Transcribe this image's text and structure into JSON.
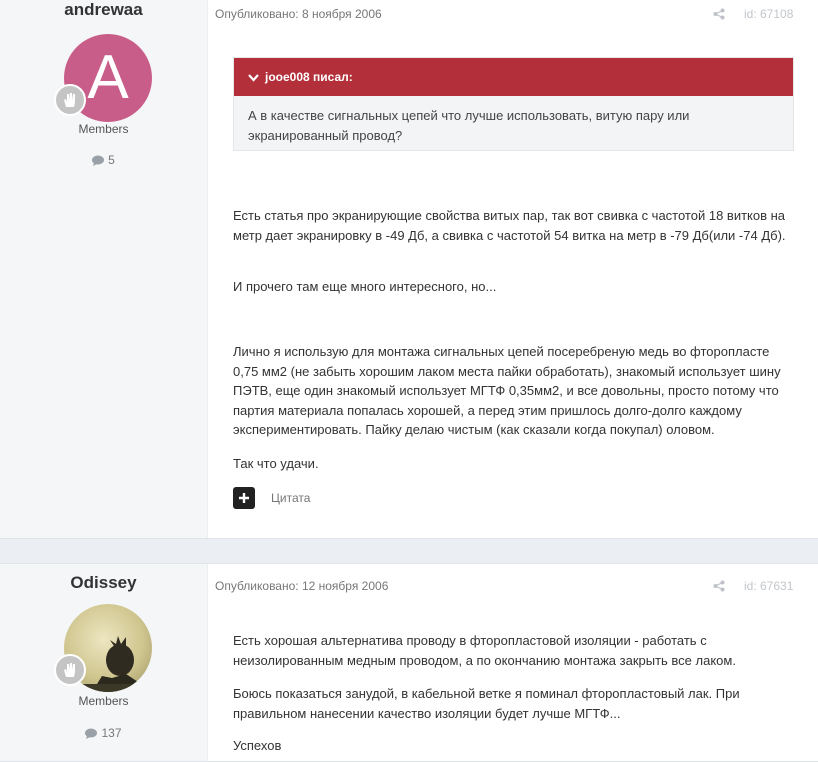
{
  "posts": [
    {
      "author": "andrewaa",
      "avatar_letter": "A",
      "group": "Members",
      "count": "5",
      "meta": "Опубликовано: 8 ноября 2006",
      "id": "id: 67108",
      "quote": {
        "header": "jooe008 писал:",
        "text": "А в качестве сигнальных цепей что лучше использовать, витую пару или экранированный провод?"
      },
      "paragraphs": [
        "Есть статья про экранирующие свойства витых пар, так вот свивка с частотой 18 витков на метр дает экранировку в -49 Дб, а свивка с частотой 54 витка на метр в -79 Дб(или -74 Дб).",
        "И прочего там еще много интересного, но...",
        "Лично я использую для монтажа сигнальных цепей посеребреную медь во фторопласте 0,75 мм2 (не забыть хорошим лаком места пайки обработать), знакомый использует шину ПЭТВ, еще один знакомый использует МГТФ 0,35мм2, и все довольны, просто потому что партия материала попалась хорошей, а перед этим пришлось долго-долго каждому экспериментировать. Пайку делаю чистым (как сказали когда покупал) оловом.",
        "Так что удачи."
      ],
      "cite_label": "Цитата"
    },
    {
      "author": "Odissey",
      "group": "Members",
      "count": "137",
      "meta": "Опубликовано: 12 ноября 2006",
      "id": "id: 67631",
      "paragraphs": [
        "Есть хорошая альтернатива проводу в фторопластовой изоляции - работать с неизолированным медным проводом, а по окончанию монтажа закрыть все лаком.",
        "Боюсь показаться занудой, в кабельной ветке я поминал фторопластовый лак. При правильном нанесении качество изоляции будет лучше МГТФ...",
        "Успехов"
      ]
    }
  ],
  "icons": {
    "share": "share-icon",
    "comment": "comment-icon",
    "quote_toggle": "chevron-down-icon",
    "rank": "hand-icon",
    "multiquote": "plus-icon"
  },
  "colors": {
    "quote_header": "#b3303a",
    "avatar_a": "#c95d8a"
  }
}
